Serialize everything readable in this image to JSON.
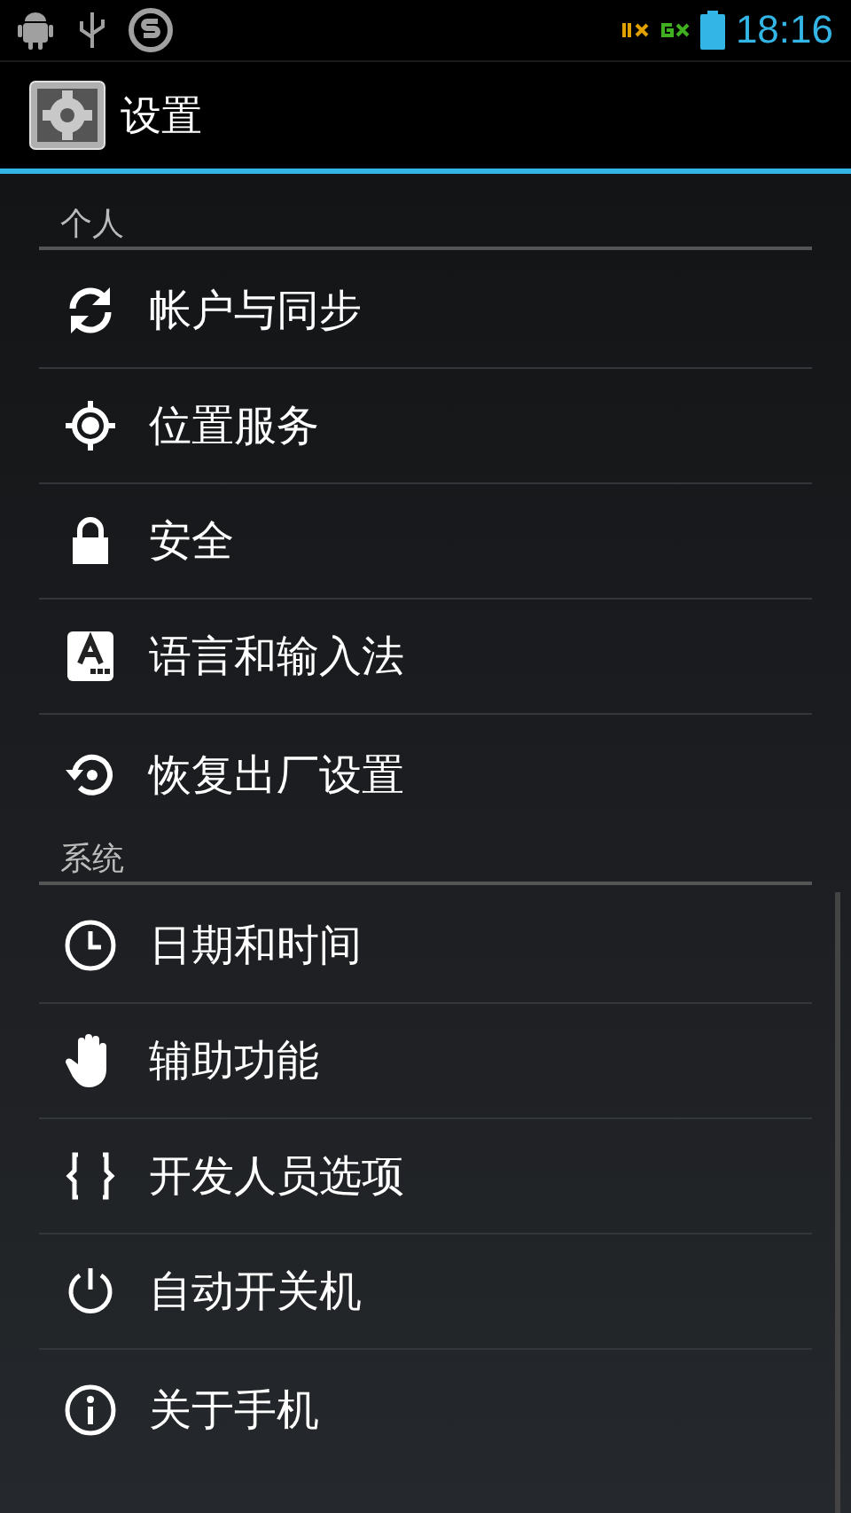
{
  "status_bar": {
    "time": "18:16"
  },
  "action_bar": {
    "title": "设置"
  },
  "sections": [
    {
      "header": "个人",
      "items": [
        {
          "label": "帐户与同步",
          "kind": "sync"
        },
        {
          "label": "位置服务",
          "kind": "location"
        },
        {
          "label": "安全",
          "kind": "lock"
        },
        {
          "label": "语言和输入法",
          "kind": "language"
        },
        {
          "label": "恢复出厂设置",
          "kind": "restore"
        }
      ]
    },
    {
      "header": "系统",
      "items": [
        {
          "label": "日期和时间",
          "kind": "clock"
        },
        {
          "label": "辅助功能",
          "kind": "hand"
        },
        {
          "label": "开发人员选项",
          "kind": "braces"
        },
        {
          "label": "自动开关机",
          "kind": "power"
        },
        {
          "label": "关于手机",
          "kind": "info"
        }
      ]
    }
  ]
}
